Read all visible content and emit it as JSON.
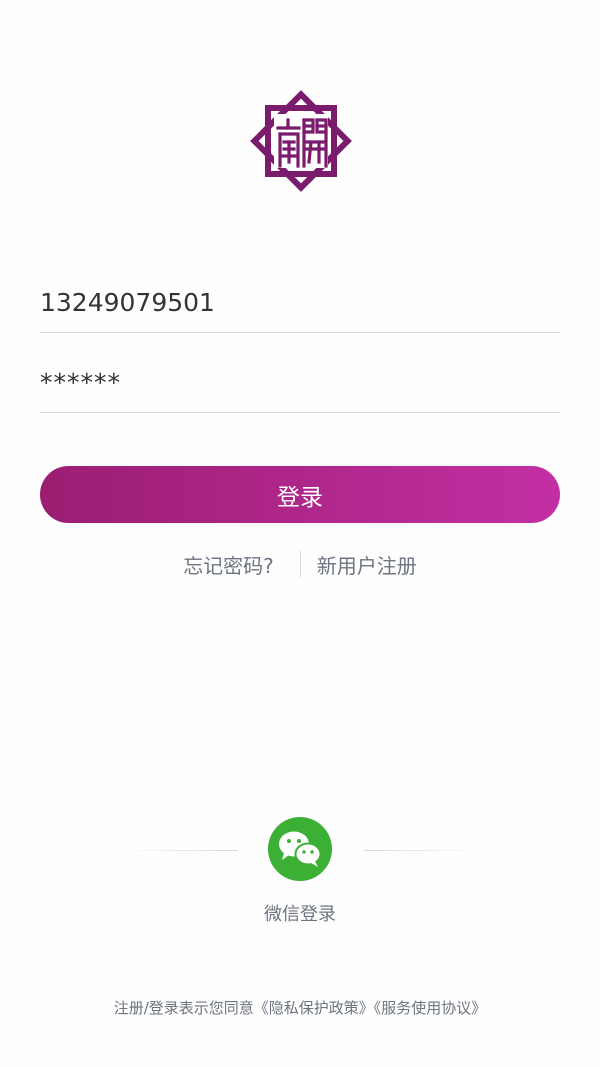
{
  "logo": {
    "glyphs": "南開",
    "color": "#7b1b6e"
  },
  "login_form": {
    "phone_value": "13249079501",
    "password_value": "******",
    "login_label": "登录"
  },
  "links": {
    "forgot_password": "忘记密码?",
    "register": "新用户注册"
  },
  "wechat": {
    "label": "微信登录",
    "color": "#3cb035"
  },
  "agreement": {
    "prefix": "注册/登录表示您同意",
    "privacy_policy": "《隐私保护政策》",
    "service_agreement": "《服务使用协议》"
  },
  "colors": {
    "brand_start": "#9b1e72",
    "brand_end": "#c32fa3",
    "secondary_text": "#6d7480"
  }
}
